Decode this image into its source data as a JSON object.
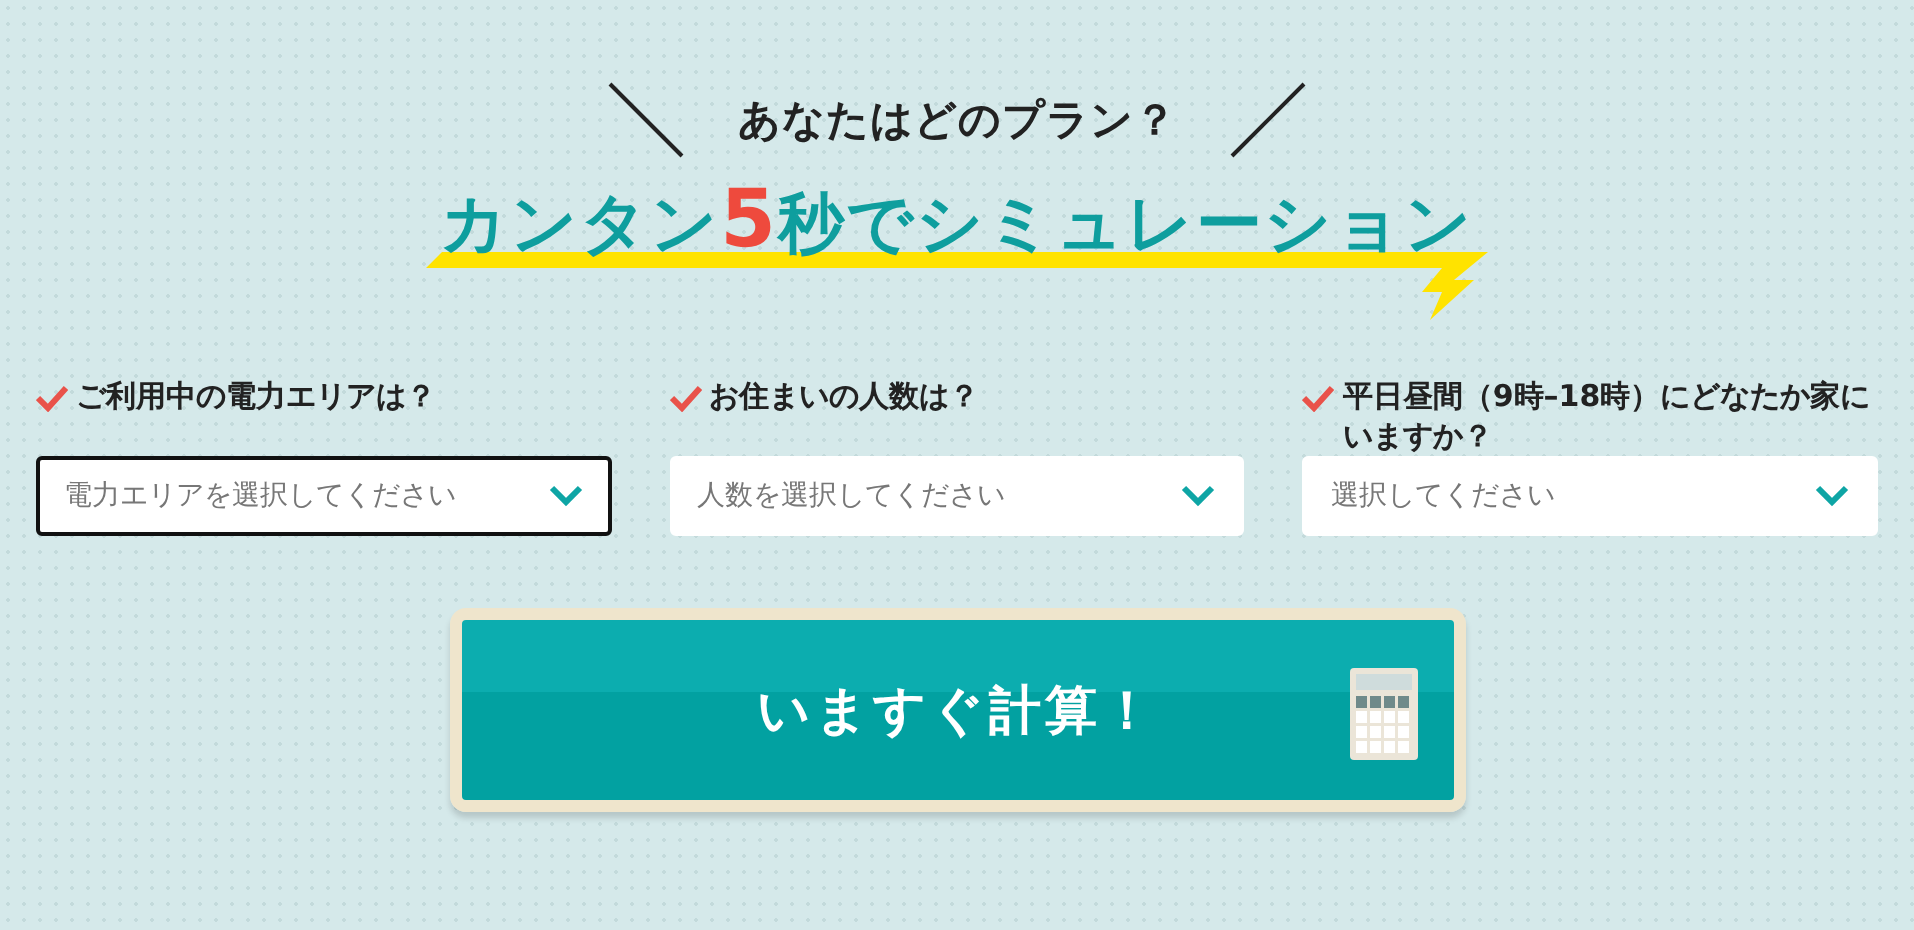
{
  "header": {
    "question": "あなたはどのプラン？",
    "headline": {
      "before": "カンタン",
      "number": "5",
      "after": "秒でシミュレーション"
    }
  },
  "questions": [
    {
      "label": "ご利用中の電力エリアは？",
      "placeholder": "電力エリアを選択してください",
      "focused": true
    },
    {
      "label": "お住まいの人数は？",
      "placeholder": "人数を選択してください",
      "focused": false
    },
    {
      "label": "平日昼間（9時–18時）にどなたか家にいますか？",
      "placeholder": "選択してください",
      "focused": false
    }
  ],
  "submit": {
    "label": "いますぐ計算！"
  }
}
